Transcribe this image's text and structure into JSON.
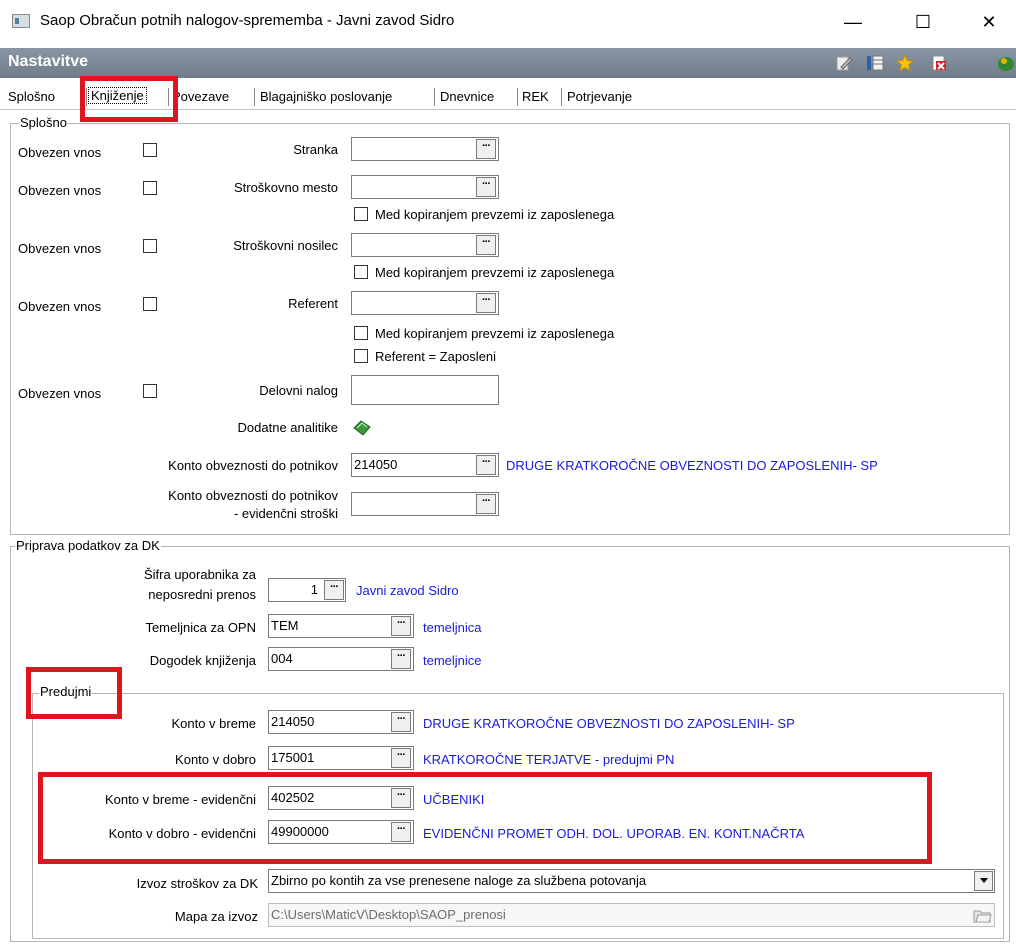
{
  "window": {
    "title": "Saop Obračun potnih nalogov-sprememba - Javni zavod Sidro",
    "minimize": "—",
    "maximize": "☐",
    "close": "✕"
  },
  "header": {
    "title": "Nastavitve",
    "icons": [
      "edit-icon",
      "columns-icon",
      "star-icon",
      "delete-icon",
      "exit-icon"
    ]
  },
  "tabs": [
    {
      "label": "Splošno",
      "active": false
    },
    {
      "label": "Knjiženje",
      "active": true
    },
    {
      "label": "Povezave",
      "active": false
    },
    {
      "label": "Blagajniško poslovanje",
      "active": false
    },
    {
      "label": "Dnevnice",
      "active": false
    },
    {
      "label": "REK",
      "active": false
    },
    {
      "label": "Potrjevanje",
      "active": false
    }
  ],
  "splosno": {
    "title": "Splošno",
    "obvezen_vnos": "Obvezen vnos",
    "stranka": "Stranka",
    "stroskovno_mesto": "Stroškovno mesto",
    "stroskovni_nosilec": "Stroškovni nosilec",
    "referent": "Referent",
    "med_kopiranjem": "Med kopiranjem prevzemi iz zaposlenega",
    "referent_zaposleni": "Referent = Zaposleni",
    "delovni_nalog": "Delovni nalog",
    "dodatne_analitike": "Dodatne analitike",
    "konto_obveznosti": "Konto obveznosti do potnikov",
    "konto_obveznosti_value": "214050",
    "konto_obveznosti_desc": "DRUGE KRATKOROČNE OBVEZNOSTI DO ZAPOSLENIH- SP",
    "konto_obveznosti_ev_1": "Konto obveznosti do potnikov",
    "konto_obveznosti_ev_2": "- evidenčni stroški",
    "konto_obveznosti_ev_value": ""
  },
  "priprava": {
    "title": "Priprava podatkov za DK",
    "sifra_1": "Šifra uporabnika za",
    "sifra_2": "neposredni prenos",
    "sifra_value": "1",
    "sifra_desc": "Javni zavod Sidro",
    "temeljnica_label": "Temeljnica za OPN",
    "temeljnica_value": "TEM",
    "temeljnica_desc": "temeljnica",
    "dogodek_label": "Dogodek knjiženja",
    "dogodek_value": "004",
    "dogodek_desc": "temeljnice"
  },
  "predujmi": {
    "title": "Predujmi",
    "breme_label": "Konto v breme",
    "breme_value": "214050",
    "breme_desc": "DRUGE KRATKOROČNE OBVEZNOSTI DO ZAPOSLENIH- SP",
    "dobro_label": "Konto v dobro",
    "dobro_value": "175001",
    "dobro_desc": "KRATKOROČNE TERJATVE - predujmi PN",
    "breme_ev_label": "Konto v breme - evidenčni",
    "breme_ev_value": "402502",
    "breme_ev_desc": "UČBENIKI",
    "dobro_ev_label": "Konto v dobro - evidenčni",
    "dobro_ev_value": "49900000",
    "dobro_ev_desc": "EVIDENČNI PROMET ODH. DOL. UPORAB. EN. KONT.NAČRTA"
  },
  "izvoz": {
    "label": "Izvoz stroškov za DK",
    "value": "Zbirno po kontih za vse prenesene naloge za službena potovanja",
    "mapa_label": "Mapa za izvoz",
    "mapa_value": "C:\\Users\\MaticV\\Desktop\\SAOP_prenosi"
  },
  "colors": {
    "header_bg": "#7a8693",
    "link_blue": "#1a1adc",
    "annotation_red": "#e0141e"
  }
}
